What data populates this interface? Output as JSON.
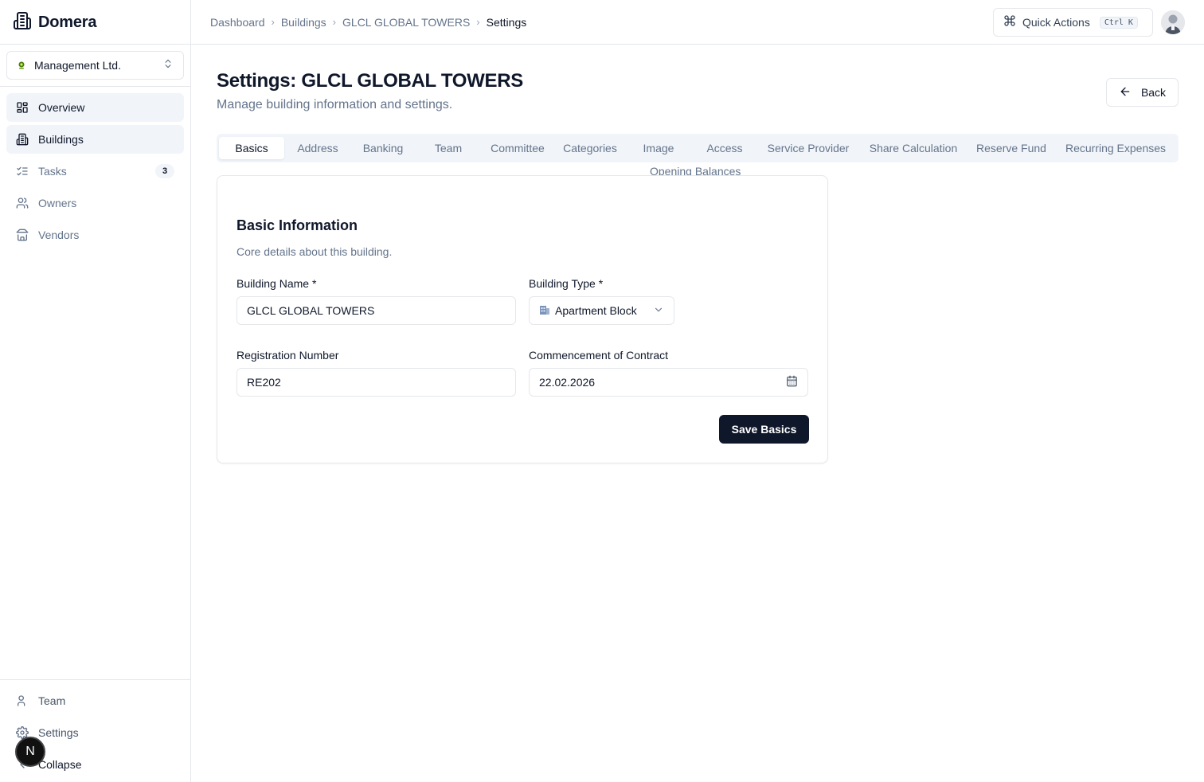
{
  "app": {
    "name": "Domera"
  },
  "org": {
    "name": "Management Ltd."
  },
  "sidebar": {
    "items": [
      {
        "label": "Overview",
        "icon": "layout-grid-icon",
        "active": false
      },
      {
        "label": "Buildings",
        "icon": "building-icon",
        "active": true
      },
      {
        "label": "Tasks",
        "icon": "list-checks-icon",
        "badge": "3"
      },
      {
        "label": "Owners",
        "icon": "users-icon"
      },
      {
        "label": "Vendors",
        "icon": "store-icon"
      }
    ],
    "bottom": [
      {
        "label": "Team",
        "icon": "users-icon"
      },
      {
        "label": "Settings",
        "icon": "gear-icon"
      },
      {
        "label": "Collapse",
        "icon": "chevron-left-icon"
      }
    ],
    "n_badge": "N"
  },
  "header": {
    "breadcrumb": [
      "Dashboard",
      "Buildings",
      "GLCL GLOBAL TOWERS",
      "Settings"
    ],
    "quick_actions": {
      "label": "Quick Actions",
      "shortcut": "Ctrl K"
    }
  },
  "page": {
    "title": "Settings: GLCL GLOBAL TOWERS",
    "subtitle": "Manage building information and settings.",
    "back_label": "Back"
  },
  "tabs": [
    "Basics",
    "Address",
    "Banking",
    "Team",
    "Committee",
    "Categories",
    "Image",
    "Access",
    "Service Provider",
    "Share Calculation",
    "Reserve Fund",
    "Recurring Expenses",
    "Opening Balances"
  ],
  "active_tab": "Basics",
  "form": {
    "title": "Basic Information",
    "description": "Core details about this building.",
    "building_name": {
      "label": "Building Name *",
      "value": "GLCL GLOBAL TOWERS"
    },
    "building_type": {
      "label": "Building Type *",
      "value": "Apartment Block",
      "icon": "building-emoji-icon"
    },
    "registration_number": {
      "label": "Registration Number",
      "value": "RE202"
    },
    "commencement": {
      "label": "Commencement of Contract",
      "value": "22.02.2026"
    },
    "save_label": "Save Basics"
  },
  "colors": {
    "primary": "#0f172a",
    "muted": "#64748b",
    "border": "#e5e7eb",
    "surface": "#f1f5f9"
  }
}
